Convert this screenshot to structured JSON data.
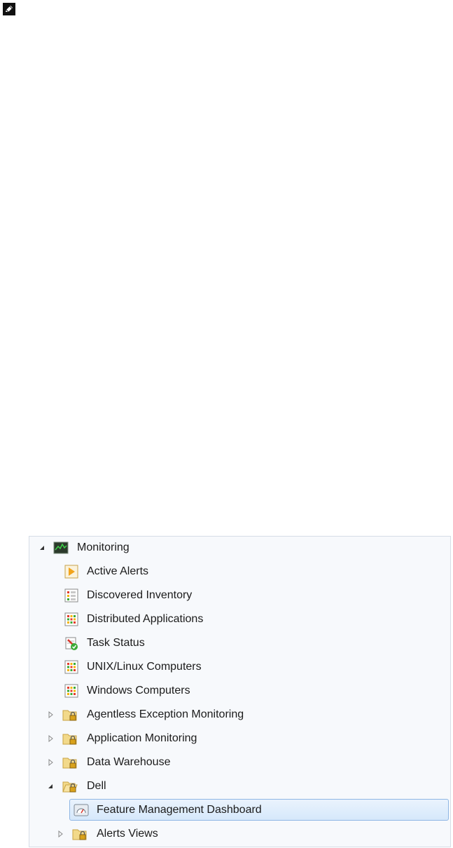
{
  "tree": {
    "root": {
      "label": "Monitoring",
      "expanded": true,
      "icon": "monitoring-icon"
    },
    "children": [
      {
        "label": "Active Alerts",
        "icon": "alert-view-icon"
      },
      {
        "label": "Discovered Inventory",
        "icon": "state-view-icon"
      },
      {
        "label": "Distributed Applications",
        "icon": "state-grid-icon"
      },
      {
        "label": "Task Status",
        "icon": "task-status-icon"
      },
      {
        "label": "UNIX/Linux Computers",
        "icon": "state-grid-icon"
      },
      {
        "label": "Windows Computers",
        "icon": "state-grid-icon"
      },
      {
        "label": "Agentless Exception Monitoring",
        "icon": "locked-folder-icon",
        "expandable": true
      },
      {
        "label": "Application Monitoring",
        "icon": "locked-folder-icon",
        "expandable": true
      },
      {
        "label": "Data Warehouse",
        "icon": "locked-folder-icon",
        "expandable": true
      },
      {
        "label": "Dell",
        "icon": "open-locked-folder-icon",
        "expanded": true
      },
      {
        "label": "Feature Management Dashboard",
        "icon": "dashboard-icon",
        "selected": true
      },
      {
        "label": "Alerts Views",
        "icon": "locked-folder-icon",
        "expandable": true
      }
    ]
  },
  "colors": {
    "selection_border": "#8fb6e4",
    "selection_fill": "#d6e8fb",
    "panel_bg": "#f7f9fc"
  }
}
